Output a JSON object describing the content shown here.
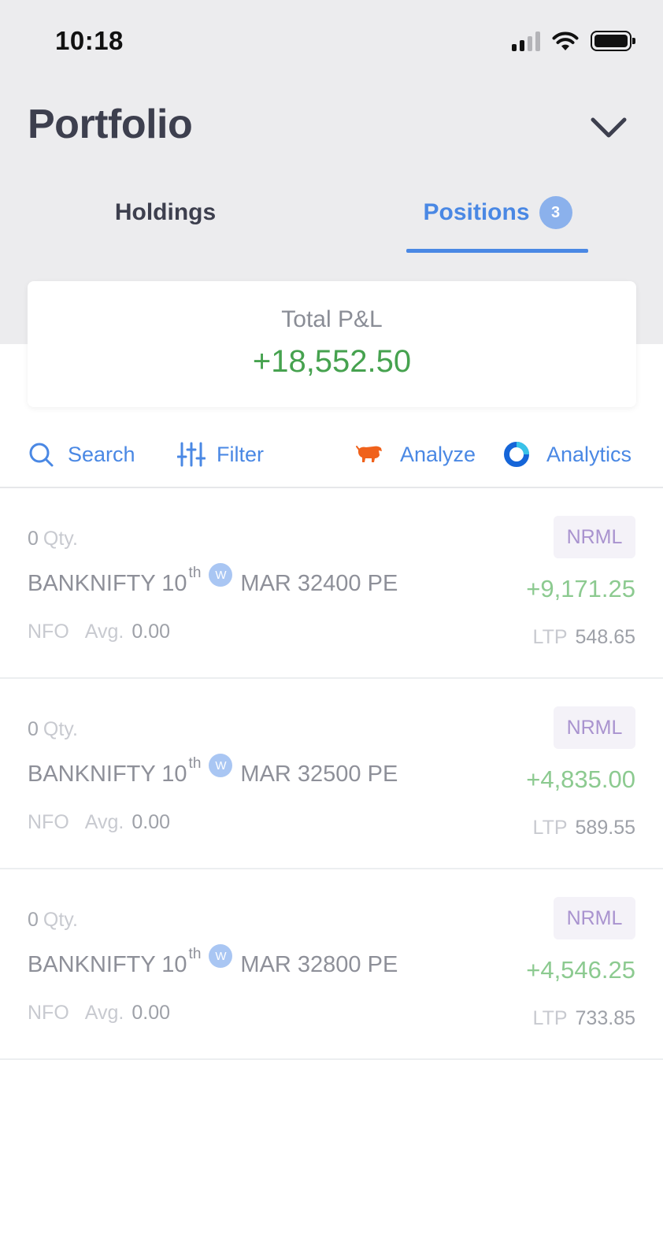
{
  "status_bar": {
    "time": "10:18"
  },
  "header": {
    "title": "Portfolio"
  },
  "tabs": [
    {
      "label": "Holdings",
      "active": false
    },
    {
      "label": "Positions",
      "badge": "3",
      "active": true
    }
  ],
  "summary": {
    "label": "Total P&L",
    "value": "+18,552.50"
  },
  "toolbar": {
    "search": "Search",
    "filter": "Filter",
    "analyze": "Analyze",
    "analytics": "Analytics"
  },
  "positions": [
    {
      "qty": "0",
      "qty_unit": "Qty.",
      "symbol": "BANKNIFTY 10",
      "ordinal": "th",
      "weekly_badge": "W",
      "contract": "MAR 32400 PE",
      "exchange": "NFO",
      "avg_label": "Avg.",
      "avg": "0.00",
      "product": "NRML",
      "pnl": "+9,171.25",
      "ltp_label": "LTP",
      "ltp": "548.65"
    },
    {
      "qty": "0",
      "qty_unit": "Qty.",
      "symbol": "BANKNIFTY 10",
      "ordinal": "th",
      "weekly_badge": "W",
      "contract": "MAR 32500 PE",
      "exchange": "NFO",
      "avg_label": "Avg.",
      "avg": "0.00",
      "product": "NRML",
      "pnl": "+4,835.00",
      "ltp_label": "LTP",
      "ltp": "589.55"
    },
    {
      "qty": "0",
      "qty_unit": "Qty.",
      "symbol": "BANKNIFTY 10",
      "ordinal": "th",
      "weekly_badge": "W",
      "contract": "MAR 32800 PE",
      "exchange": "NFO",
      "avg_label": "Avg.",
      "avg": "0.00",
      "product": "NRML",
      "pnl": "+4,546.25",
      "ltp_label": "LTP",
      "ltp": "733.85"
    }
  ],
  "colors": {
    "accent": "#4a88e4",
    "profit": "#46a24f",
    "profit_light": "#8cca90",
    "product_tag": "#a993cf",
    "analyze_icon": "#f0621c"
  },
  "icons": {
    "dropdown": "chevron-down-icon",
    "search": "search-icon",
    "filter": "filter-sliders-icon",
    "analyze": "bull-icon",
    "analytics": "analytics-ring-icon"
  }
}
